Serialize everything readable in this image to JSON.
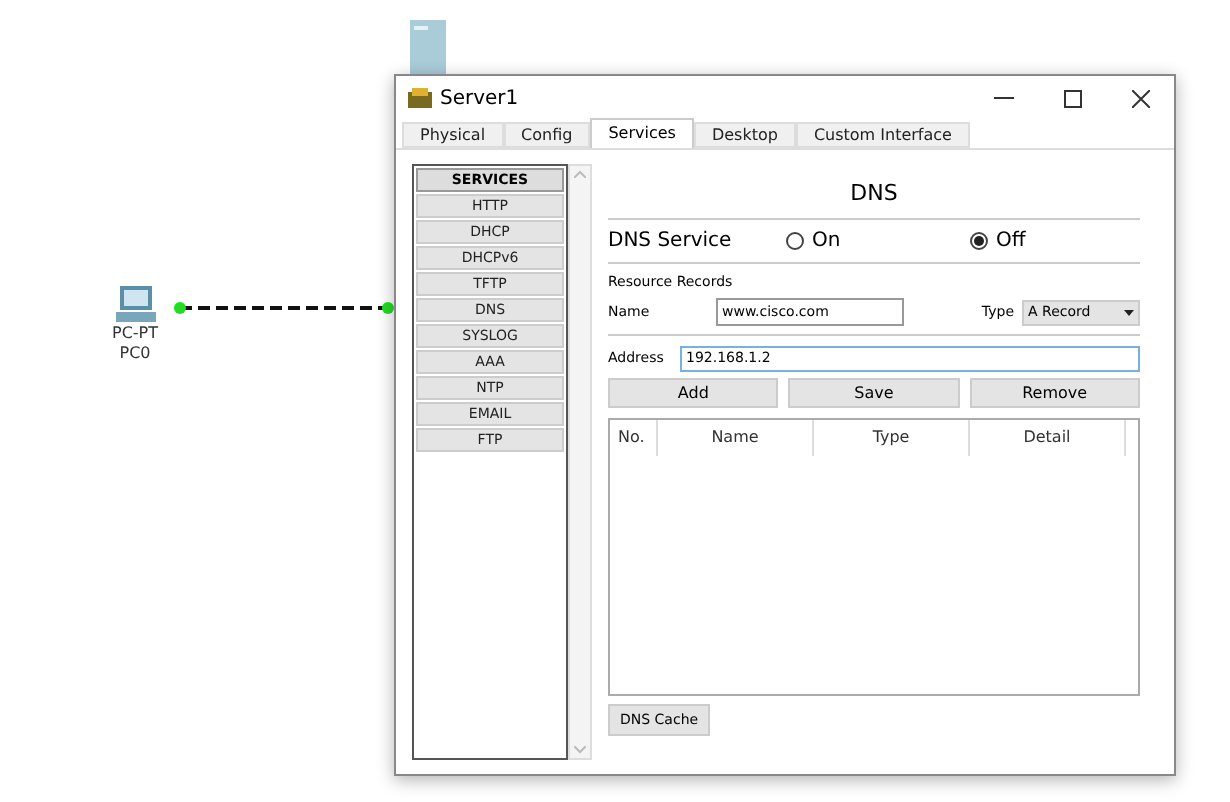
{
  "canvas": {
    "devices": [
      {
        "kind": "pc",
        "model": "PC-PT",
        "name": "PC0"
      },
      {
        "kind": "server"
      }
    ]
  },
  "window": {
    "title": "Server1",
    "tabs": [
      {
        "label": "Physical",
        "selected": false
      },
      {
        "label": "Config",
        "selected": false
      },
      {
        "label": "Services",
        "selected": true
      },
      {
        "label": "Desktop",
        "selected": false
      },
      {
        "label": "Custom Interface",
        "selected": false
      }
    ],
    "services": {
      "heading": "SERVICES",
      "items": [
        "HTTP",
        "DHCP",
        "DHCPv6",
        "TFTP",
        "DNS",
        "SYSLOG",
        "AAA",
        "NTP",
        "EMAIL",
        "FTP"
      ]
    },
    "dns": {
      "heading": "DNS",
      "service_label": "DNS Service",
      "service_options": [
        {
          "label": "On",
          "selected": false
        },
        {
          "label": "Off",
          "selected": true
        }
      ],
      "records_label": "Resource Records",
      "name_label": "Name",
      "name_value": "www.cisco.com",
      "type_label": "Type",
      "type_value": "A Record",
      "address_label": "Address",
      "address_value": "192.168.1.2",
      "buttons": [
        "Add",
        "Save",
        "Remove"
      ],
      "table": {
        "columns": [
          "No.",
          "Name",
          "Type",
          "Detail"
        ]
      },
      "cache_button": "DNS Cache"
    }
  }
}
